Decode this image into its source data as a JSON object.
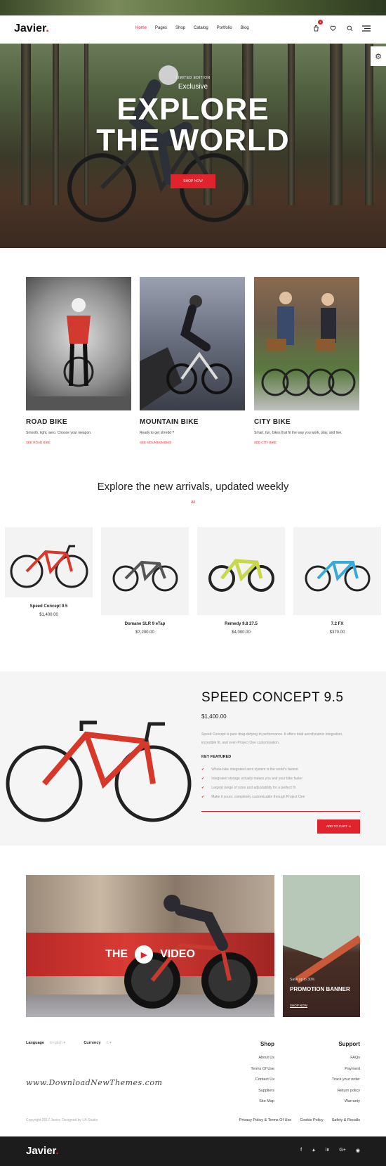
{
  "header": {
    "logo": "Javier",
    "logo_dot": ".",
    "nav": [
      "Home",
      "Pages",
      "Shop",
      "Catalog",
      "Portfolio",
      "Blog"
    ],
    "active_nav": "Home",
    "cart_count": "1",
    "icons": [
      "cart-icon",
      "heart-icon",
      "search-icon",
      "menu-icon"
    ]
  },
  "hero": {
    "small": "LIMITED EDITION",
    "exclusive": "Exclusive",
    "line1": "EXPLORE",
    "line2": "THE WORLD",
    "button": "SHOP NOW"
  },
  "categories": [
    {
      "title": "ROAD BIKE",
      "desc": "Smooth, light, aero. Choose your weapon.",
      "link": "SEE ROAD BIKE"
    },
    {
      "title": "MOUNTAIN BIKE",
      "desc": "Ready to get shredd ?",
      "link": "SEE MOUNTAIN BIKE"
    },
    {
      "title": "CITY BIKE",
      "desc": "Smart, fun, bikes that fit the way you work, play, and live.",
      "link": "SEE CITY BIKE"
    }
  ],
  "arrivals": {
    "title": "Explore the new arrivals, updated weekly",
    "filter": "All",
    "products": [
      {
        "name": "Speed Concept 9.5",
        "price": "$1,400.00",
        "color": "#d8382a"
      },
      {
        "name": "Domane SLR 9 eTap",
        "price": "$7,200.00",
        "color": "#555555"
      },
      {
        "name": "Remedy 9.8 27.5",
        "price": "$4,000.00",
        "color": "#c8d84a"
      },
      {
        "name": "7.2 FX",
        "price": "$370.00",
        "color": "#3aa8d8"
      }
    ]
  },
  "featured": {
    "title": "SPEED CONCEPT 9.5",
    "price": "$1,400.00",
    "desc": "Speed Concept is pure drag-defying tri performance. It offers total aerodynamic integration, incredible fit, and even Project One customisation.",
    "key_title": "KEY FEATURED",
    "features": [
      "Whole-bike integrated aero system is the world's fastest",
      "Integrated storage actually makes you and your bike faster",
      "Largest range of sizes and adjustability for a perfect fit",
      "Make it yours: completely customizable through Project One"
    ],
    "button": "ADD TO CART"
  },
  "video": {
    "left": "THE",
    "right": "VIDEO"
  },
  "promo": {
    "small": "Save up to 30%",
    "title": "PROMOTION BANNER",
    "link": "SHOP NOW"
  },
  "footer": {
    "language_label": "Language",
    "language_value": "English",
    "currency_label": "Currency",
    "currency_value": "£",
    "shop_title": "Shop",
    "shop_links": [
      "About Us",
      "Terms Of Use",
      "Contact Us",
      "Suppliers",
      "Site Map"
    ],
    "support_title": "Support",
    "support_links": [
      "FAQs",
      "Payment",
      "Track your order",
      "Return policy",
      "Warranty"
    ],
    "watermark": "www.DownloadNewThemes.com",
    "copyright": "Copyright 2017 Javier. Designed by LA-Studio",
    "legal": [
      "Privacy Policy & Terms Of Use",
      "Cookie Policy",
      "Safety & Recalls"
    ],
    "logo": "Javier",
    "social": [
      "facebook-icon",
      "twitter-icon",
      "linkedin-icon",
      "google-plus-icon",
      "instagram-icon"
    ]
  },
  "colors": {
    "accent": "#e0232d",
    "dark": "#1c1c1c"
  }
}
